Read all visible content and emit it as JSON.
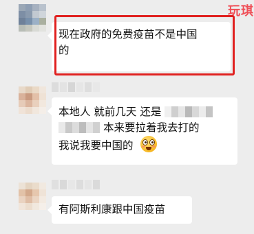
{
  "watermark": "玩琪",
  "messages": [
    {
      "id": "msg1",
      "lines": [
        "现在政府的免费疫苗不是中国",
        "的"
      ],
      "highlighted": true
    },
    {
      "id": "msg2",
      "line1": "本地人 就前几天 还是",
      "line2_suffix": "本来要拉着我去打的",
      "line3": "我说我要中国的",
      "emoji": "flushed-face-emoji"
    },
    {
      "id": "msg3",
      "text": "有阿斯利康跟中国疫苗"
    }
  ],
  "colors": {
    "background": "#ededed",
    "bubble": "#ffffff",
    "highlight": "#e0201f",
    "watermark": "#ef4f57"
  }
}
